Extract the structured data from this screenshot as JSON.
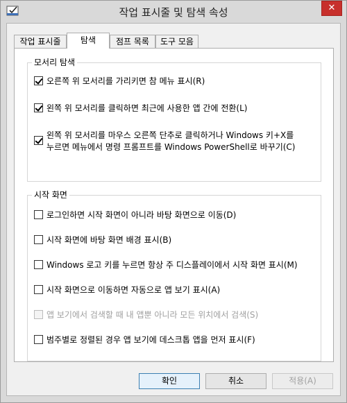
{
  "window": {
    "title": "작업 표시줄 및 탐색 속성",
    "close_glyph": "✕"
  },
  "tabs": [
    {
      "label": "작업 표시줄",
      "active": false
    },
    {
      "label": "탐색",
      "active": true
    },
    {
      "label": "점프 목록",
      "active": false
    },
    {
      "label": "도구 모음",
      "active": false
    }
  ],
  "corner_navigation": {
    "legend": "모서리 탐색",
    "options": [
      {
        "label": "오른쪽 위 모서리를 가리키면 참 메뉴 표시(R)",
        "checked": true,
        "enabled": true
      },
      {
        "label": "왼쪽 위 모서리를 클릭하면 최근에 사용한 앱 간에 전환(L)",
        "checked": true,
        "enabled": true
      },
      {
        "label_line1": "왼쪽 위 모서리를 마우스 오른쪽 단추로 클릭하거나 Windows 키+X를",
        "label_line2": "누르면 메뉴에서 명령 프롬프트를 Windows PowerShell로 바꾸기(C)",
        "checked": true,
        "enabled": true
      }
    ]
  },
  "start_screen": {
    "legend": "시작 화면",
    "options": [
      {
        "label": "로그인하면 시작 화면이 아니라 바탕 화면으로 이동(D)",
        "checked": false,
        "enabled": true
      },
      {
        "label": "시작 화면에 바탕 화면 배경 표시(B)",
        "checked": false,
        "enabled": true
      },
      {
        "label": "Windows 로고 키를 누르면 항상 주 디스플레이에서 시작 화면 표시(M)",
        "checked": false,
        "enabled": true
      },
      {
        "label": "시작 화면으로 이동하면 자동으로 앱 보기 표시(A)",
        "checked": false,
        "enabled": true
      },
      {
        "label": "앱 보기에서 검색할 때 내 앱뿐 아니라 모든 위치에서 검색(S)",
        "checked": false,
        "enabled": false
      },
      {
        "label": "범주별로 정렬된 경우 앱 보기에 데스크톱 앱을 먼저 표시(F)",
        "checked": false,
        "enabled": true
      }
    ]
  },
  "buttons": {
    "ok": "확인",
    "cancel": "취소",
    "apply": "적용(A)"
  },
  "colors": {
    "close_button": "#c7302c",
    "default_button_border": "#3c7fb1"
  }
}
